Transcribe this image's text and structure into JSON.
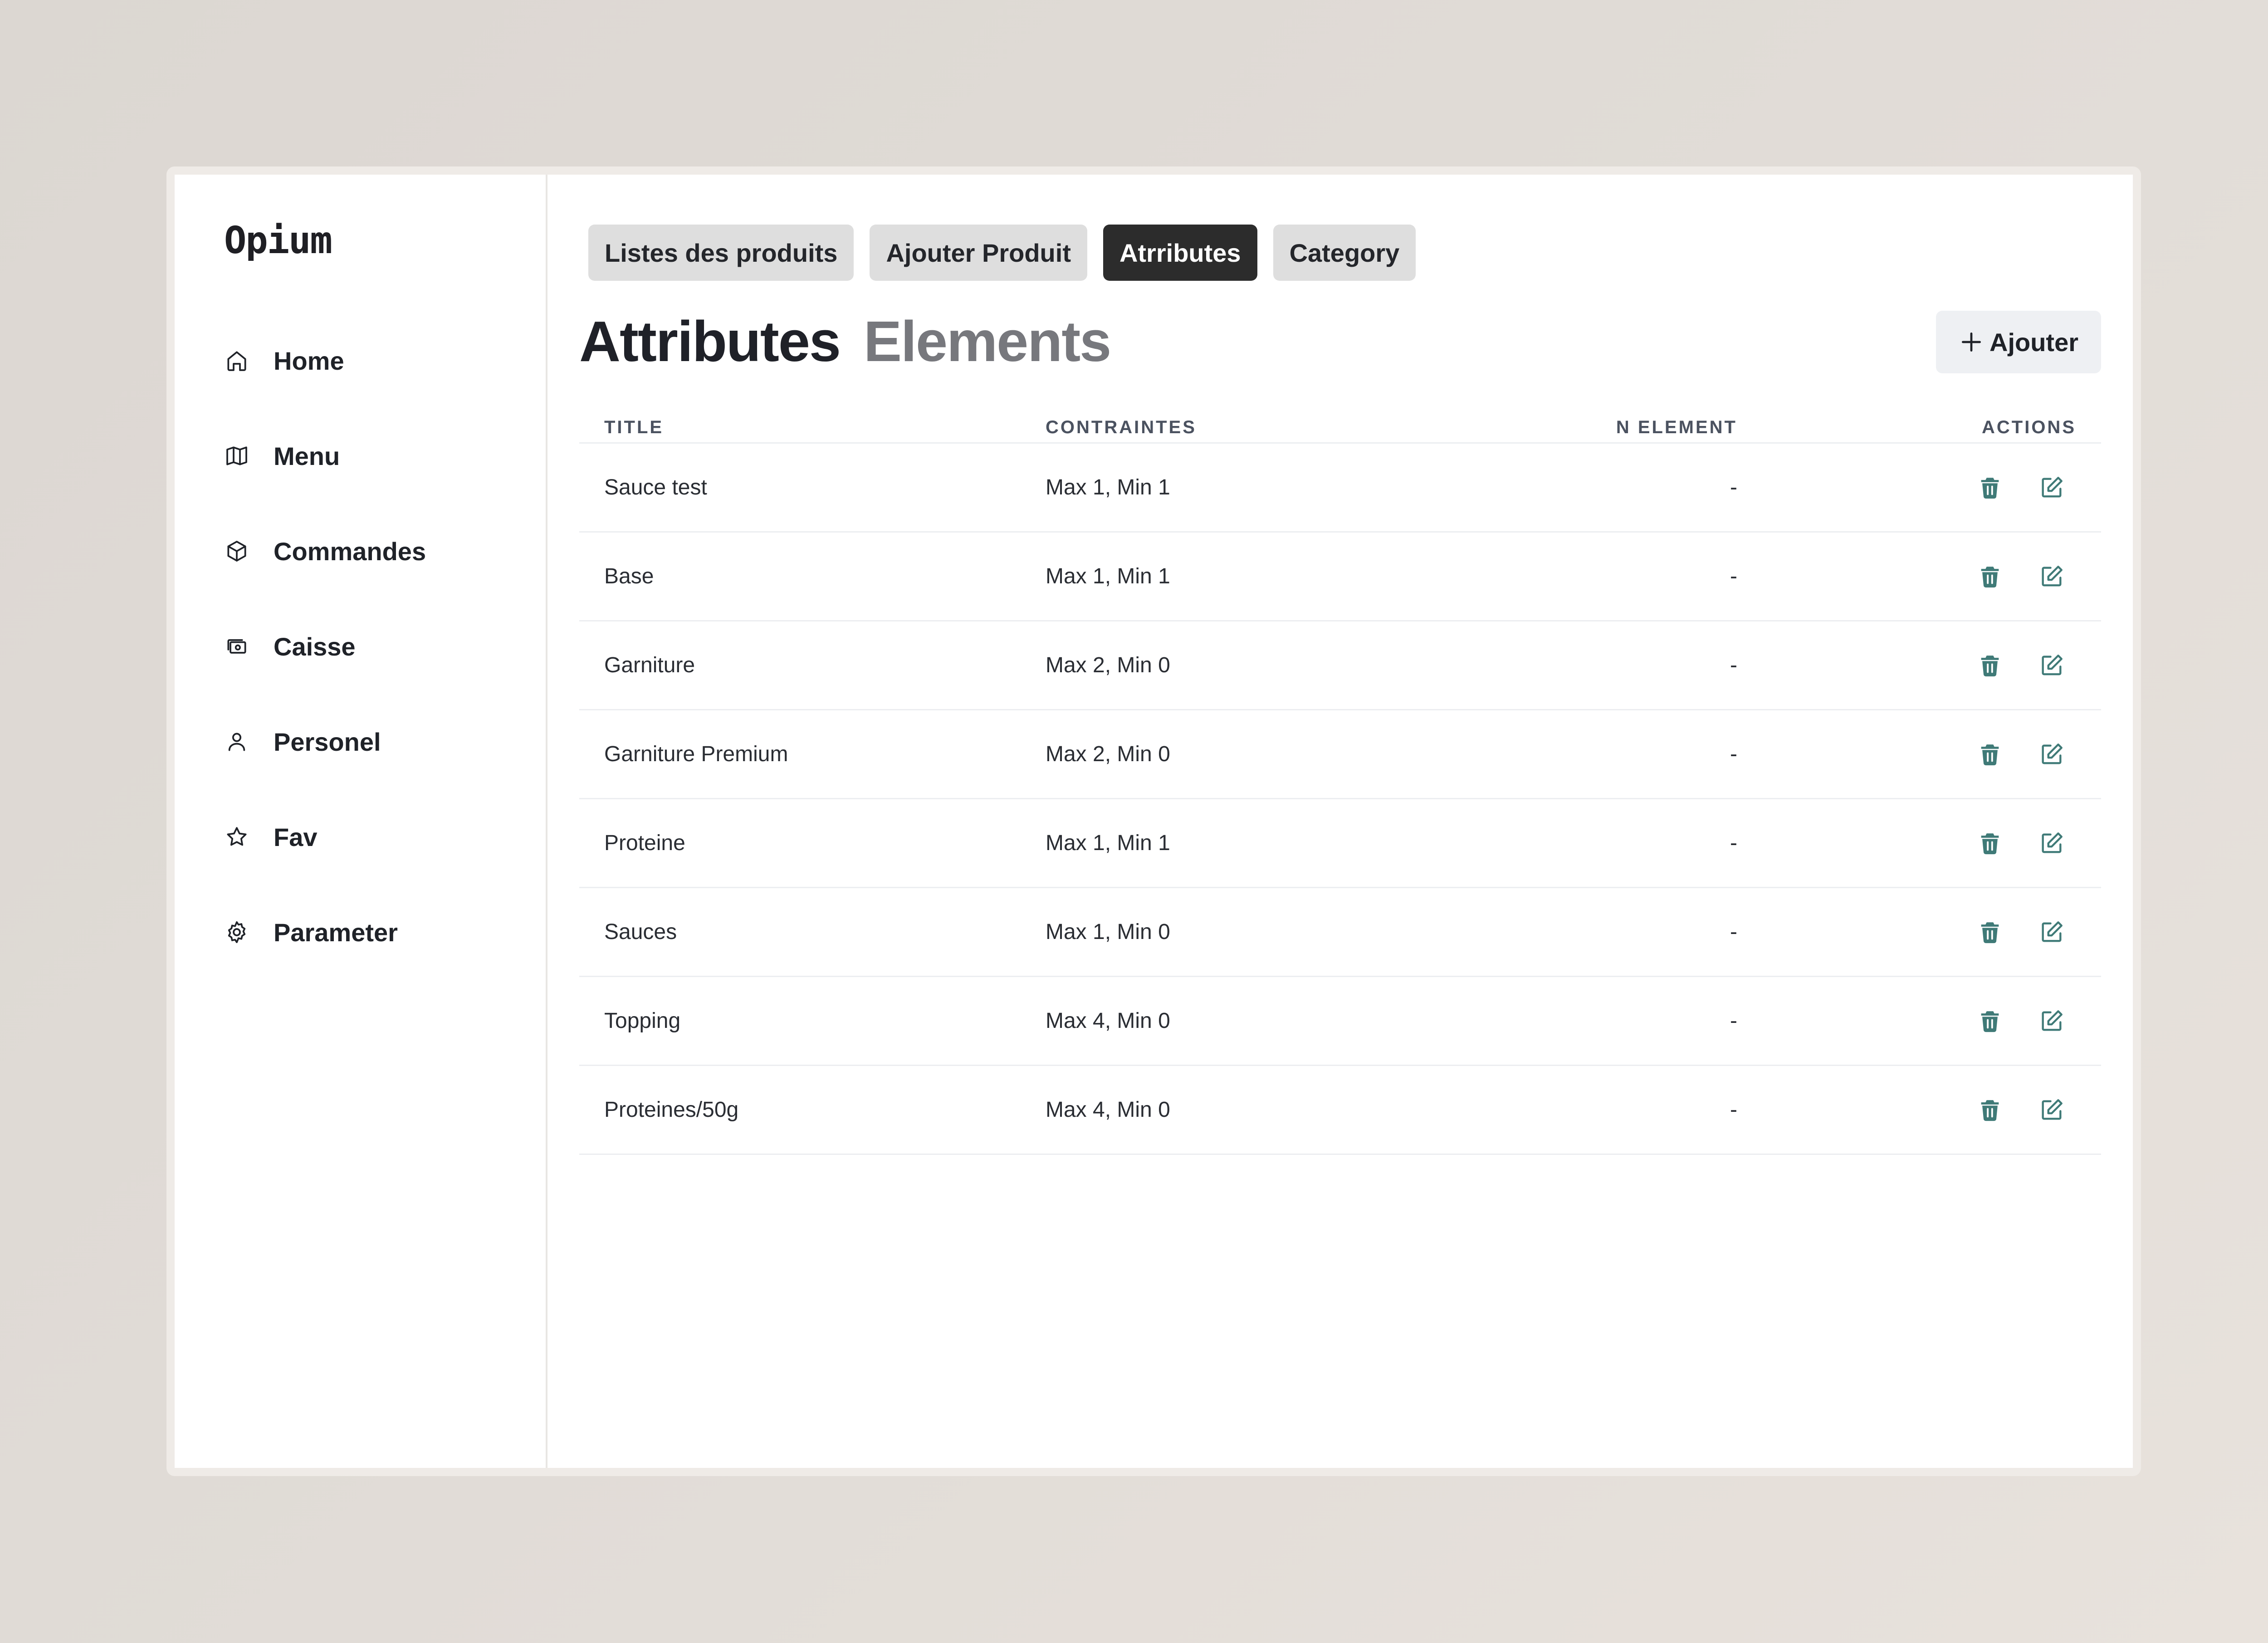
{
  "app": {
    "name": "Opium"
  },
  "sidebar": {
    "items": [
      {
        "label": "Home",
        "icon": "home-icon"
      },
      {
        "label": "Menu",
        "icon": "map-icon"
      },
      {
        "label": "Commandes",
        "icon": "cube-icon"
      },
      {
        "label": "Caisse",
        "icon": "cash-icon"
      },
      {
        "label": "Personel",
        "icon": "user-icon"
      },
      {
        "label": "Fav",
        "icon": "star-icon"
      },
      {
        "label": "Parameter",
        "icon": "gear-icon"
      }
    ]
  },
  "tabs": [
    {
      "label": "Listes des produits",
      "active": false
    },
    {
      "label": "Ajouter Produit",
      "active": false
    },
    {
      "label": "Atrributes",
      "active": true
    },
    {
      "label": "Category",
      "active": false
    }
  ],
  "heading": {
    "main": "Attributes",
    "secondary": "Elements"
  },
  "add_button": {
    "label": "Ajouter",
    "icon": "plus-icon"
  },
  "table": {
    "columns": [
      "TITLE",
      "CONTRAINTES",
      "N ELEMENT",
      "ACTIONS"
    ],
    "rows": [
      {
        "title": "Sauce test",
        "contraintes": "Max 1, Min 1",
        "n_element": "-"
      },
      {
        "title": "Base",
        "contraintes": "Max 1, Min 1",
        "n_element": "-"
      },
      {
        "title": "Garniture",
        "contraintes": "Max 2, Min 0",
        "n_element": "-"
      },
      {
        "title": "Garniture Premium",
        "contraintes": "Max 2, Min 0",
        "n_element": "-"
      },
      {
        "title": "Proteine",
        "contraintes": "Max 1, Min 1",
        "n_element": "-"
      },
      {
        "title": "Sauces",
        "contraintes": "Max 1, Min 0",
        "n_element": "-"
      },
      {
        "title": "Topping",
        "contraintes": "Max 4, Min 0",
        "n_element": "-"
      },
      {
        "title": "Proteines/50g",
        "contraintes": "Max 4, Min 0",
        "n_element": "-"
      }
    ],
    "action_icons": [
      "trash-icon",
      "edit-icon"
    ]
  },
  "colors": {
    "action_icon": "#3f7a77",
    "active_tab": "#2c2c2c",
    "inactive_tab": "#dedede",
    "add_button_bg": "#eef0f3"
  }
}
